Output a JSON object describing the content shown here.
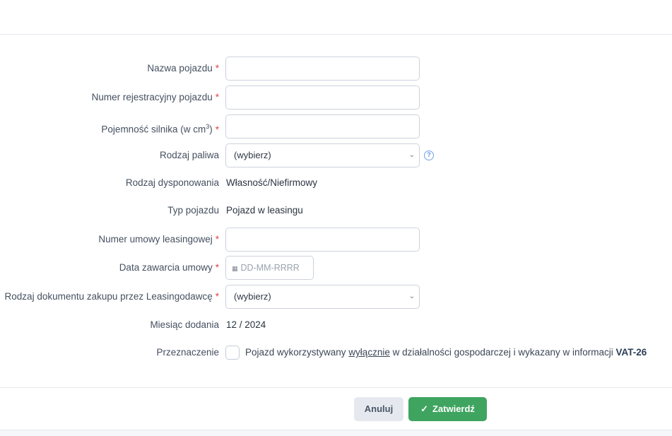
{
  "form": {
    "vehicle_name": {
      "label": "Nazwa pojazdu",
      "required": "*",
      "value": ""
    },
    "registration_number": {
      "label": "Numer rejestracyjny pojazdu",
      "required": "*",
      "value": ""
    },
    "engine_capacity": {
      "label_prefix": "Pojemność silnika (w cm",
      "label_sup": "3",
      "label_suffix": ")",
      "required": "*",
      "value": ""
    },
    "fuel_type": {
      "label": "Rodzaj paliwa",
      "selected": "(wybierz)",
      "help_icon": "question-circle-icon"
    },
    "disposal_type": {
      "label": "Rodzaj dysponowania",
      "value": "Własność/Niefirmowy"
    },
    "vehicle_type": {
      "label": "Typ pojazdu",
      "value": "Pojazd w leasingu"
    },
    "leasing_contract_number": {
      "label": "Numer umowy leasingowej",
      "required": "*",
      "value": ""
    },
    "contract_date": {
      "label": "Data zawarcia umowy",
      "required": "*",
      "placeholder": "DD-MM-RRRR",
      "icon": "calendar-icon"
    },
    "purchase_document_type": {
      "label": "Rodzaj dokumentu zakupu przez Leasingodawcę",
      "required": "*",
      "selected": "(wybierz)"
    },
    "month_added": {
      "label": "Miesiąc dodania",
      "value": "12 / 2024"
    },
    "purpose": {
      "label": "Przeznaczenie",
      "checked": false,
      "text_before": "Pojazd wykorzystywany ",
      "text_underlined": "wyłącznie",
      "text_middle": " w działalności gospodarczej i wykazany w informacji ",
      "text_bold": "VAT-26"
    }
  },
  "buttons": {
    "cancel_label": "Anuluj",
    "submit_label": "Zatwierdź"
  },
  "colors": {
    "required": "#e04545",
    "submit": "#3fa45f",
    "cancel": "#e5e9ef",
    "help": "#5e93e4"
  }
}
